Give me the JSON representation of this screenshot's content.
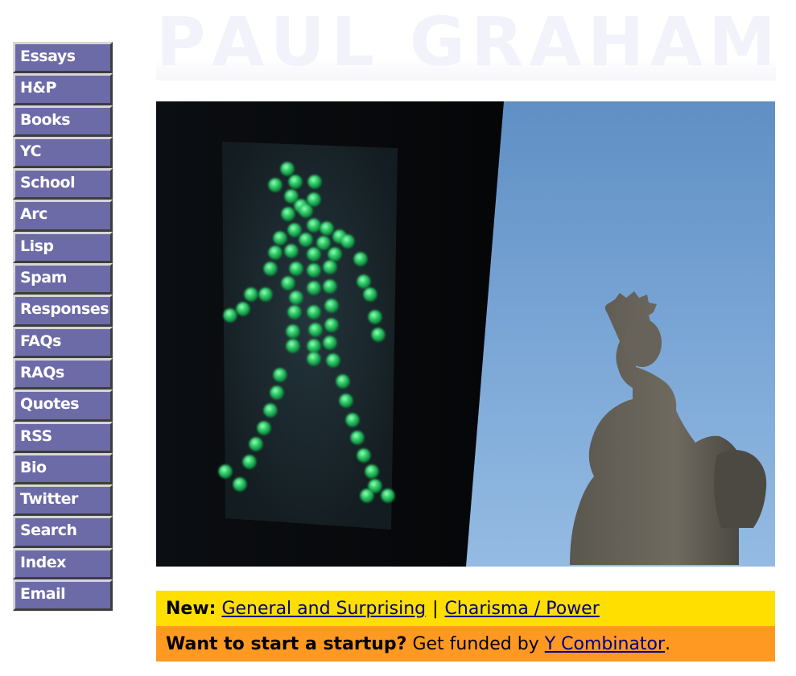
{
  "title": {
    "letters": [
      "P",
      "A",
      "U",
      "L",
      "G",
      "R",
      "A",
      "H",
      "A",
      "M"
    ]
  },
  "nav": {
    "items": [
      {
        "label": "Essays",
        "name": "nav-essays"
      },
      {
        "label": "H&P",
        "name": "nav-hp"
      },
      {
        "label": "Books",
        "name": "nav-books"
      },
      {
        "label": "YC",
        "name": "nav-yc"
      },
      {
        "label": "School",
        "name": "nav-school"
      },
      {
        "label": "Arc",
        "name": "nav-arc"
      },
      {
        "label": "Lisp",
        "name": "nav-lisp"
      },
      {
        "label": "Spam",
        "name": "nav-spam"
      },
      {
        "label": "Responses",
        "name": "nav-responses"
      },
      {
        "label": "FAQs",
        "name": "nav-faqs"
      },
      {
        "label": "RAQs",
        "name": "nav-raqs"
      },
      {
        "label": "Quotes",
        "name": "nav-quotes"
      },
      {
        "label": "RSS",
        "name": "nav-rss"
      },
      {
        "label": "Bio",
        "name": "nav-bio"
      },
      {
        "label": "Twitter",
        "name": "nav-twitter"
      },
      {
        "label": "Search",
        "name": "nav-search"
      },
      {
        "label": "Index",
        "name": "nav-index"
      },
      {
        "label": "Email",
        "name": "nav-email"
      }
    ]
  },
  "colors": {
    "nav_bg": "#6d6aa8",
    "new_banner_bg": "#ffdf00",
    "startup_banner_bg": "#ff9922",
    "link": "#000080"
  },
  "banner_new": {
    "label": "New:",
    "link1": "General and Surprising",
    "separator": "|",
    "link2": "Charisma / Power"
  },
  "banner_startup": {
    "label": "Want to start a startup?",
    "text": "Get funded by",
    "link": "Y Combinator",
    "end": "."
  }
}
